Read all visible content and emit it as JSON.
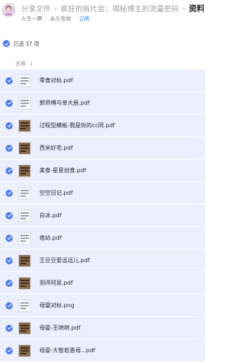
{
  "header": {
    "breadcrumb": [
      "分享文件",
      "疯狂的拆片会：揭秘博主的流量密码",
      "资料"
    ],
    "owner": "人生一票",
    "validity": "永久有效",
    "subscribe": "订阅"
  },
  "selection": {
    "text": "已选 37 项"
  },
  "columns": {
    "name": "名称",
    "sort_icon": "↓"
  },
  "files": [
    {
      "name": "零食对标.pdf",
      "thumb": "doc"
    },
    {
      "name": "郭师傅与单大厨.pdf",
      "thumb": "doc"
    },
    {
      "name": "过程型模板-我是你的cc同.pdf",
      "thumb": "photo"
    },
    {
      "name": "西米好宅.pdf",
      "thumb": "photo"
    },
    {
      "name": "美食-星星创食.pdf",
      "thumb": "photo"
    },
    {
      "name": "空空日记.pdf",
      "thumb": "doc"
    },
    {
      "name": "白冰.pdf",
      "thumb": "doc"
    },
    {
      "name": "痞幼.pdf",
      "thumb": "doc"
    },
    {
      "name": "王豆豆爱逗逗儿.pdf",
      "thumb": "photo"
    },
    {
      "name": "测评阿吴.pdf",
      "thumb": "photo"
    },
    {
      "name": "母婴对标.png",
      "thumb": "doc"
    },
    {
      "name": "母婴-王哄哄.pdf",
      "thumb": "photo"
    },
    {
      "name": "母婴-大智若愚母...pdf",
      "thumb": "photo"
    }
  ],
  "colors": {
    "accent": "#4a78e8",
    "row_bg": "#eceffd",
    "link": "#2a7de1"
  }
}
